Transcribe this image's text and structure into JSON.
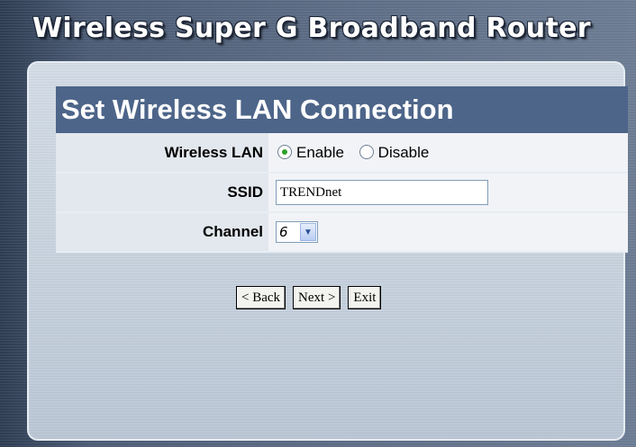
{
  "header": {
    "title": "Wireless Super G Broadband Router"
  },
  "section": {
    "title": "Set Wireless LAN Connection"
  },
  "form": {
    "wireless_lan": {
      "label": "Wireless LAN",
      "options": [
        "Enable",
        "Disable"
      ],
      "selected": "Enable"
    },
    "ssid": {
      "label": "SSID",
      "value": "TRENDnet"
    },
    "channel": {
      "label": "Channel",
      "value": "6"
    }
  },
  "buttons": {
    "back": "< Back",
    "next": "Next >",
    "exit": "Exit"
  }
}
